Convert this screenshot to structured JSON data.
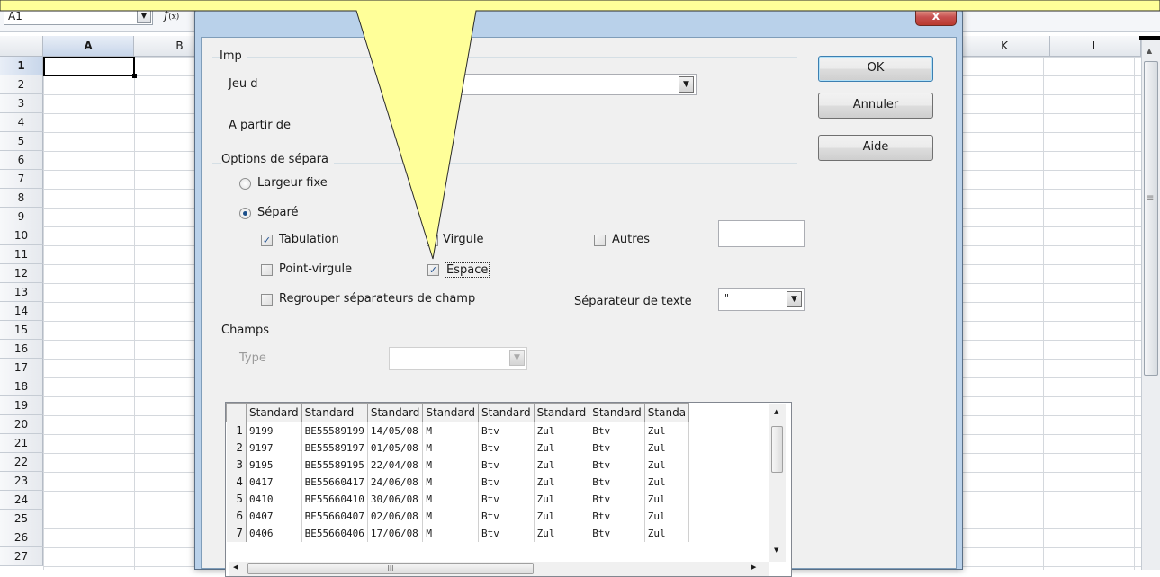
{
  "spreadsheet": {
    "namebox_value": "A1",
    "fx_label": "f(x)",
    "columns": [
      "A",
      "B",
      "K",
      "L"
    ],
    "rows": [
      "1",
      "2",
      "3",
      "4",
      "5",
      "6",
      "7",
      "8",
      "9",
      "10",
      "11",
      "12",
      "13",
      "14",
      "15",
      "16",
      "17",
      "18",
      "19",
      "20",
      "21",
      "22",
      "23",
      "24",
      "25",
      "26",
      "27"
    ]
  },
  "dialog": {
    "close_glyph": "x",
    "import_group_label": "Imp",
    "charset_label": "Jeu d",
    "from_row_label": "A partir de",
    "separator_group_label": "Options de sépara",
    "fixed_width_label": "Largeur fixe",
    "separated_label": "Séparé",
    "tab_label": "Tabulation",
    "comma_label": "Virgule",
    "other_label": "Autres",
    "semicolon_label": "Point-virgule",
    "space_label": "Espace",
    "merge_label": "Regrouper séparateurs de champ",
    "text_sep_label": "Séparateur de texte",
    "text_sep_value": "\"",
    "fields_group_label": "Champs",
    "type_label": "Type",
    "buttons": {
      "ok": "OK",
      "cancel": "Annuler",
      "help": "Aide"
    },
    "states": {
      "fixed_width": false,
      "separated": true,
      "tab": true,
      "comma": false,
      "other": false,
      "semicolon": false,
      "space": true,
      "merge": false
    }
  },
  "preview": {
    "headers": [
      "Standard",
      "Standard",
      "Standard",
      "Standard",
      "Standard",
      "Standard",
      "Standard",
      "Standa"
    ],
    "rows": [
      [
        "1",
        "9199",
        "BE55589199",
        "14/05/08",
        "M",
        "Btv",
        "Zul",
        "Btv",
        "Zul"
      ],
      [
        "2",
        "9197",
        "BE55589197",
        "01/05/08",
        "M",
        "Btv",
        "Zul",
        "Btv",
        "Zul"
      ],
      [
        "3",
        "9195",
        "BE55589195",
        "22/04/08",
        "M",
        "Btv",
        "Zul",
        "Btv",
        "Zul"
      ],
      [
        "4",
        "0417",
        "BE55660417",
        "24/06/08",
        "M",
        "Btv",
        "Zul",
        "Btv",
        "Zul"
      ],
      [
        "5",
        "0410",
        "BE55660410",
        "30/06/08",
        "M",
        "Btv",
        "Zul",
        "Btv",
        "Zul"
      ],
      [
        "6",
        "0407",
        "BE55660407",
        "02/06/08",
        "M",
        "Btv",
        "Zul",
        "Btv",
        "Zul"
      ],
      [
        "7",
        "0406",
        "BE55660406",
        "17/06/08",
        "M",
        "Btv",
        "Zul",
        "Btv",
        "Zul"
      ]
    ],
    "hscroll_grip": "III"
  },
  "colors": {
    "callout_fill": "#ffff99",
    "dialog_frame": "#b9d1ea",
    "close_button": "#c75050"
  }
}
